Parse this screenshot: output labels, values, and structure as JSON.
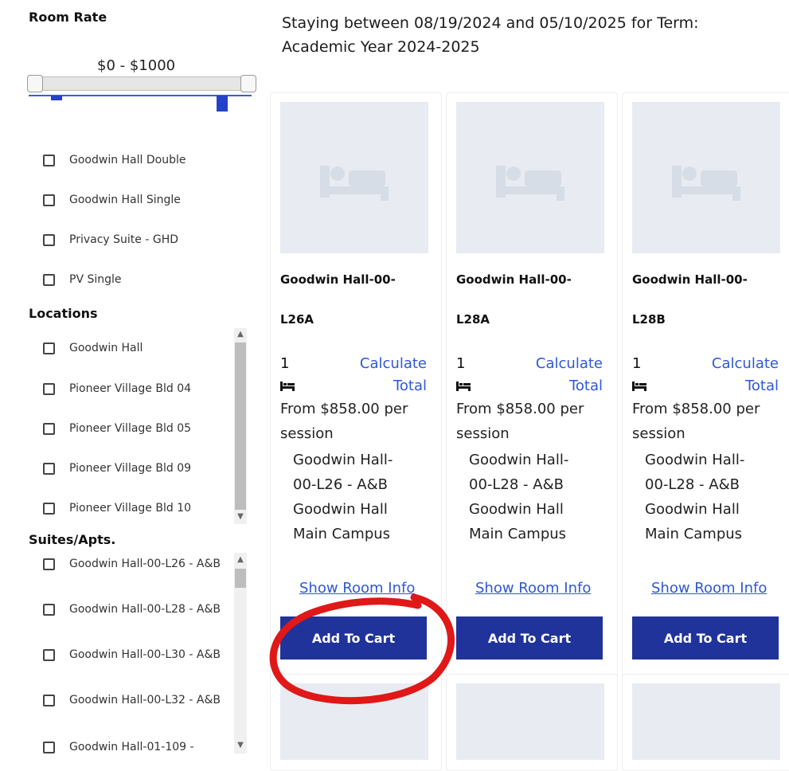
{
  "sidebar": {
    "room_rate_heading": "Room Rate",
    "range_label": "$0 - $1000",
    "room_types": [
      {
        "label": "Goodwin Hall Double"
      },
      {
        "label": "Goodwin Hall Single"
      },
      {
        "label": "Privacy Suite - GHD"
      },
      {
        "label": "PV Single"
      }
    ],
    "locations_heading": "Locations",
    "locations": [
      {
        "label": "Goodwin Hall"
      },
      {
        "label": "Pioneer Village Bld 04"
      },
      {
        "label": "Pioneer Village Bld 05"
      },
      {
        "label": "Pioneer Village Bld 09"
      },
      {
        "label": "Pioneer Village Bld 10"
      }
    ],
    "suites_heading": "Suites/Apts.",
    "suites": [
      {
        "label": "Goodwin Hall-00-L26 - A&B"
      },
      {
        "label": "Goodwin Hall-00-L28 - A&B"
      },
      {
        "label": "Goodwin Hall-00-L30 - A&B"
      },
      {
        "label": "Goodwin Hall-00-L32 - A&B"
      },
      {
        "label": "Goodwin Hall-01-109 -"
      }
    ]
  },
  "main": {
    "stay_info": "Staying between 08/19/2024 and 05/10/2025 for Term: Academic Year 2024-2025",
    "cards": [
      {
        "name_line1": "Goodwin Hall-00-",
        "name_line2": "L26A",
        "beds": "1",
        "calc_line1": "Calculate",
        "calc_line2": "Total",
        "price_line1": "From $858.00 per",
        "price_line2": "session",
        "suite_line1": "Goodwin Hall-",
        "suite_line2": "00-L26 - A&B",
        "building": "Goodwin Hall",
        "campus": "Main Campus",
        "info_link": "Show Room Info",
        "cart_button": "Add To Cart"
      },
      {
        "name_line1": "Goodwin Hall-00-",
        "name_line2": "L28A",
        "beds": "1",
        "calc_line1": "Calculate",
        "calc_line2": "Total",
        "price_line1": "From $858.00 per",
        "price_line2": "session",
        "suite_line1": "Goodwin Hall-",
        "suite_line2": "00-L28 - A&B",
        "building": "Goodwin Hall",
        "campus": "Main Campus",
        "info_link": "Show Room Info",
        "cart_button": "Add To Cart"
      },
      {
        "name_line1": "Goodwin Hall-00-",
        "name_line2": "L28B",
        "beds": "1",
        "calc_line1": "Calculate",
        "calc_line2": "Total",
        "price_line1": "From $858.00 per",
        "price_line2": "session",
        "suite_line1": "Goodwin Hall-",
        "suite_line2": "00-L28 - A&B",
        "building": "Goodwin Hall",
        "campus": "Main Campus",
        "info_link": "Show Room Info",
        "cart_button": "Add To Cart"
      }
    ]
  },
  "colors": {
    "accent": "#20339a",
    "link": "#2f57d9",
    "annotation_circle": "#e01818",
    "placeholder": "#e8ecf2"
  }
}
